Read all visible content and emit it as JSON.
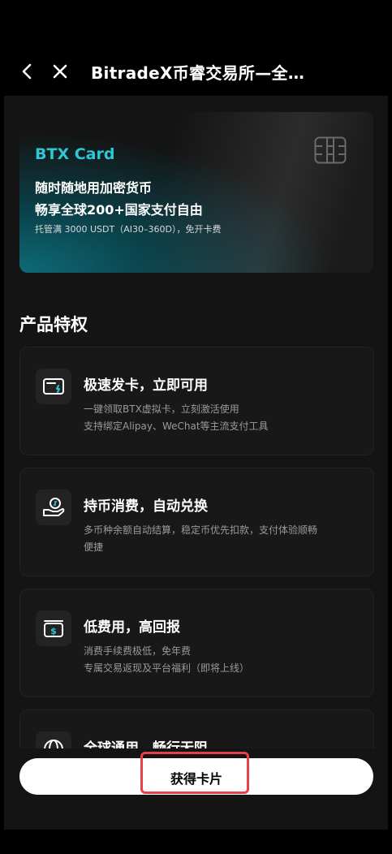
{
  "header": {
    "title": "BitradeX币睿交易所—全…"
  },
  "card": {
    "brand": "BTX Card",
    "line1": "随时随地用加密货币",
    "line2": "畅享全球200+国家支付自由",
    "sub": "托管满 3000 USDT（AI30–360D），免开卡费"
  },
  "section": {
    "title": "产品特权"
  },
  "features": [
    {
      "icon": "card-icon",
      "title": "极速发卡，立即可用",
      "desc1": "一键领取BTX虚拟卡，立刻激活使用",
      "desc2": "支持绑定Alipay、WeChat等主流支付工具"
    },
    {
      "icon": "coin-hand-icon",
      "title": "持币消费，自动兑换",
      "desc1": "多币种余额自动结算，稳定币优先扣款，支付体验顺畅",
      "desc2": "便捷"
    },
    {
      "icon": "wallet-dollar-icon",
      "title": "低费用，高回报",
      "desc1": "消费手续费极低，免年费",
      "desc2": "专属交易返现及平台福利（即将上线）"
    },
    {
      "icon": "globe-icon",
      "title": "全球通用，畅行无阻"
    }
  ],
  "cta": {
    "label": "获得卡片"
  },
  "colors": {
    "accent": "#2ec7d4",
    "highlight": "#e8404a",
    "background": "#141414"
  }
}
